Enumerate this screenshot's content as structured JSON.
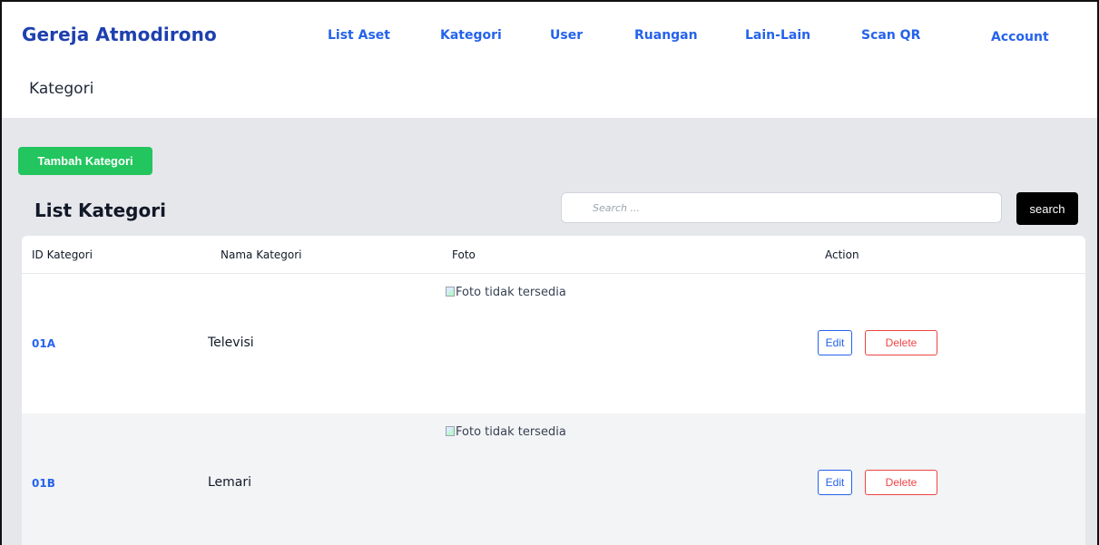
{
  "navbar": {
    "brand": "Gereja Atmodirono",
    "links": [
      "List Aset",
      "Kategori",
      "User",
      "Ruangan",
      "Lain-Lain",
      "Scan QR",
      "Account"
    ]
  },
  "page": {
    "title": "Kategori"
  },
  "toolbar": {
    "add_label": "Tambah Kategori",
    "list_title": "List Kategori",
    "search_placeholder": "Search ...",
    "search_label": "search"
  },
  "table": {
    "headers": [
      "ID Kategori",
      "Nama Kategori",
      "Foto",
      "Action"
    ],
    "rows": [
      {
        "id": "01A",
        "name": "Televisi",
        "foto_alt": "Foto tidak tersedia",
        "edit": "Edit",
        "delete": "Delete"
      },
      {
        "id": "01B",
        "name": "Lemari",
        "foto_alt": "Foto tidak tersedia",
        "edit": "Edit",
        "delete": "Delete"
      }
    ]
  },
  "colors": {
    "brand": "#1e40af",
    "link": "#2563eb",
    "add_button": "#22c55e",
    "search_button": "#000000",
    "delete": "#ef4444",
    "main_bg": "#e5e7eb"
  }
}
